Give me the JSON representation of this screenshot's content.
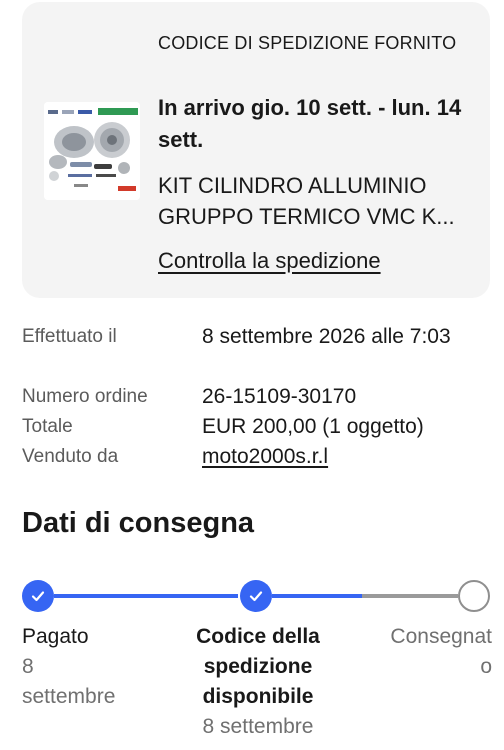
{
  "shipment": {
    "status_label": "CODICE DI SPEDIZIONE FORNITO",
    "arrival": "In arrivo gio. 10 sett. - lun. 14 sett.",
    "item_title": "KIT CILINDRO ALLUMINIO GRUPPO TERMICO VMC K...",
    "track_link": "Controlla la spedizione",
    "thumbnail_icon": "product-thumbnail"
  },
  "order": {
    "rows": [
      {
        "label": "Effettuato il",
        "value": "8 settembre 2026 alle 7:03"
      },
      {
        "label": "Numero ordine",
        "value": "26-15109-30170"
      },
      {
        "label": "Totale",
        "value": "EUR 200,00 (1 oggetto)"
      },
      {
        "label": "Venduto da",
        "value": "moto2000s.r.l"
      }
    ]
  },
  "delivery": {
    "title": "Dati di consegna",
    "accent_color": "#3665f3",
    "steps": [
      {
        "label": "Pagato",
        "date": "8 settembre",
        "state": "done"
      },
      {
        "label": "Codice della spedizione disponibile",
        "date": "8 settembre",
        "state": "done"
      },
      {
        "label": "Consegnato",
        "date": "",
        "state": "pending"
      }
    ]
  }
}
